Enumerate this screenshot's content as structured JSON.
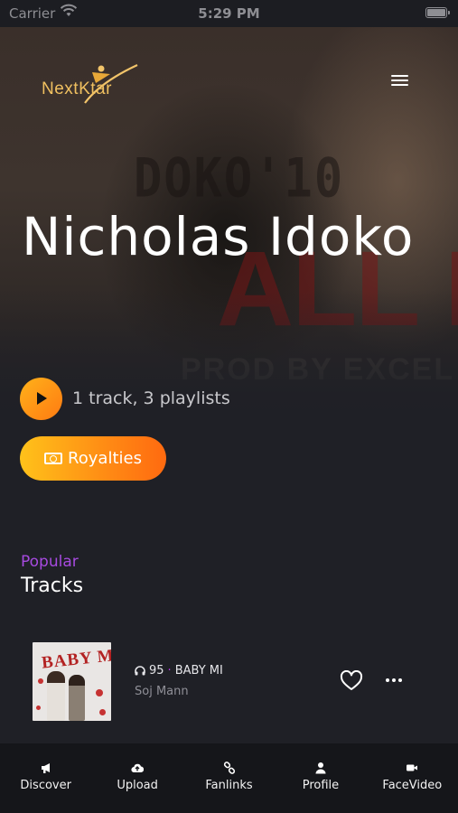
{
  "status_bar": {
    "carrier": "Carrier",
    "time": "5:29 PM"
  },
  "brand": {
    "logo_text": "NextKtar"
  },
  "header": {
    "menu_icon": "hamburger-menu-icon"
  },
  "artist": {
    "name": "Nicholas Idoko",
    "stats": "1 track, 3 playlists",
    "royalties_label": "Royalties"
  },
  "section": {
    "kicker": "Popular",
    "title": "Tracks"
  },
  "tracks": [
    {
      "plays": "95",
      "title": "BABY MI",
      "artist": "Soj Mann",
      "art_title": "BABY MI"
    }
  ],
  "tabs": [
    {
      "label": "Discover",
      "icon": "megaphone-icon"
    },
    {
      "label": "Upload",
      "icon": "cloud-upload-icon"
    },
    {
      "label": "Fanlinks",
      "icon": "link-icon"
    },
    {
      "label": "Profile",
      "icon": "user-icon"
    },
    {
      "label": "FaceVideo",
      "icon": "video-camera-icon"
    }
  ],
  "colors": {
    "accent_orange": "#ff8a14",
    "accent_yellow": "#ffc21a",
    "accent_purple": "#a74ae0",
    "background": "#1f2026",
    "tabbar": "#15161a"
  }
}
